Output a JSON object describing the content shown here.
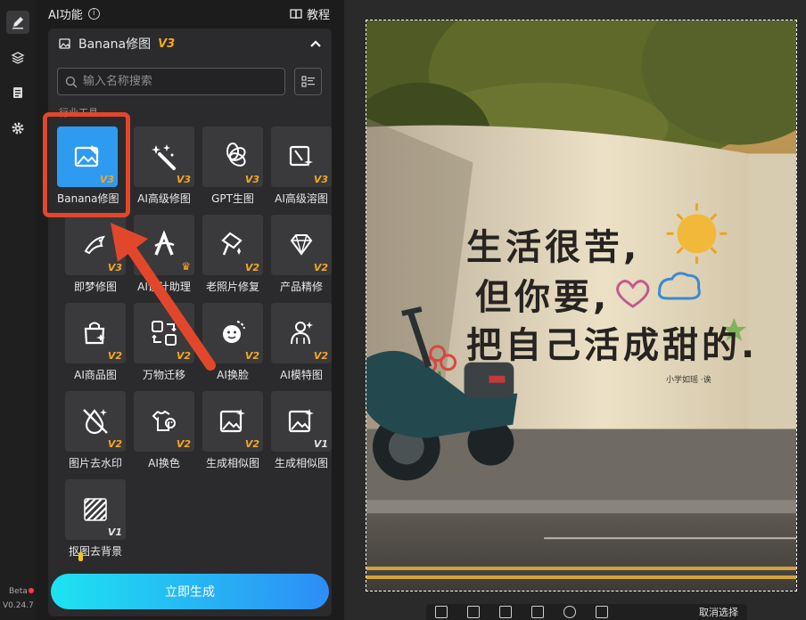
{
  "rail": {
    "beta": "Beta",
    "version": "V0.24.7"
  },
  "panel": {
    "title": "AI功能",
    "tutorial": "教程",
    "section_title": "Banana修图",
    "section_version": "V3",
    "search_placeholder": "输入名称搜索",
    "category": "行业工具",
    "tools": [
      {
        "label": "Banana修图",
        "badge": "V3",
        "icon": "image-edit-icon"
      },
      {
        "label": "AI高级修图",
        "badge": "V3",
        "icon": "magic-wand-icon"
      },
      {
        "label": "GPT生图",
        "badge": "V3",
        "icon": "gpt-knot-icon"
      },
      {
        "label": "AI高级溶图",
        "badge": "V3",
        "icon": "blend-sparkle-icon"
      },
      {
        "label": "即梦修图",
        "badge": "V3",
        "icon": "dream-bird-icon"
      },
      {
        "label": "AI设计助理",
        "badge": "crown",
        "icon": "design-assistant-icon"
      },
      {
        "label": "老照片修复",
        "badge": "V2",
        "icon": "photo-restore-icon"
      },
      {
        "label": "产品精修",
        "badge": "V2",
        "icon": "diamond-icon"
      },
      {
        "label": "AI商品图",
        "badge": "V2",
        "icon": "shopping-bag-icon"
      },
      {
        "label": "万物迁移",
        "badge": "V2",
        "icon": "transfer-icon"
      },
      {
        "label": "AI换脸",
        "badge": "V2",
        "icon": "face-swap-icon"
      },
      {
        "label": "AI模特图",
        "badge": "V2",
        "icon": "model-icon"
      },
      {
        "label": "图片去水印",
        "badge": "V2",
        "icon": "remove-watermark-icon"
      },
      {
        "label": "AI换色",
        "badge": "V2",
        "icon": "recolor-shirt-icon"
      },
      {
        "label": "生成相似图",
        "badge": "V2",
        "icon": "similar-image-icon"
      },
      {
        "label": "生成相似图",
        "badge": "V1",
        "icon": "similar-image-icon"
      },
      {
        "label": "抠图去背景",
        "badge": "V1",
        "icon": "cutout-icon"
      }
    ],
    "generate_button": "立即生成"
  },
  "canvas": {
    "wall_lines": [
      "生活很苦,",
      "但你要,",
      "把自己活成甜的."
    ],
    "wall_signature": "小学如瑶 ·诶",
    "bottom_cancel": "取消选择"
  },
  "colors": {
    "accent": "#2f9bf0",
    "highlight": "#e2472c",
    "version_badge": "#f5a623"
  }
}
